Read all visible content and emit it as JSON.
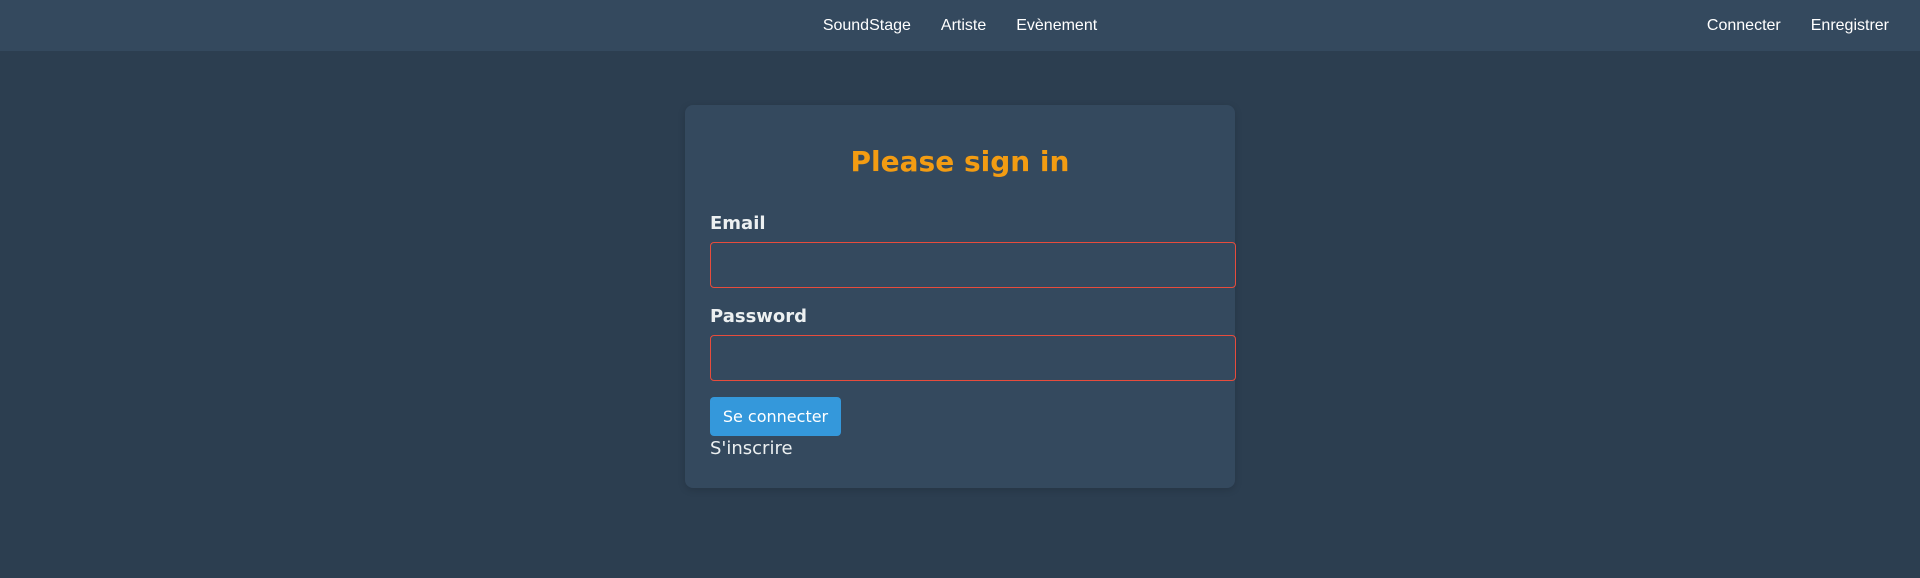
{
  "nav": {
    "center_links": [
      "SoundStage",
      "Artiste",
      "Evènement"
    ],
    "right_links": [
      "Connecter",
      "Enregistrer"
    ]
  },
  "login": {
    "title": "Please sign in",
    "email_label": "Email",
    "email_value": "",
    "password_label": "Password",
    "password_value": "",
    "submit_label": "Se connecter",
    "signup_link": "S'inscrire"
  },
  "colors": {
    "page_bg": "#2c3e50",
    "navbar_bg": "#34495e",
    "card_bg": "#34495e",
    "title_accent": "#f39c12",
    "button_bg": "#3498db",
    "input_border_error": "#e74c3c"
  }
}
